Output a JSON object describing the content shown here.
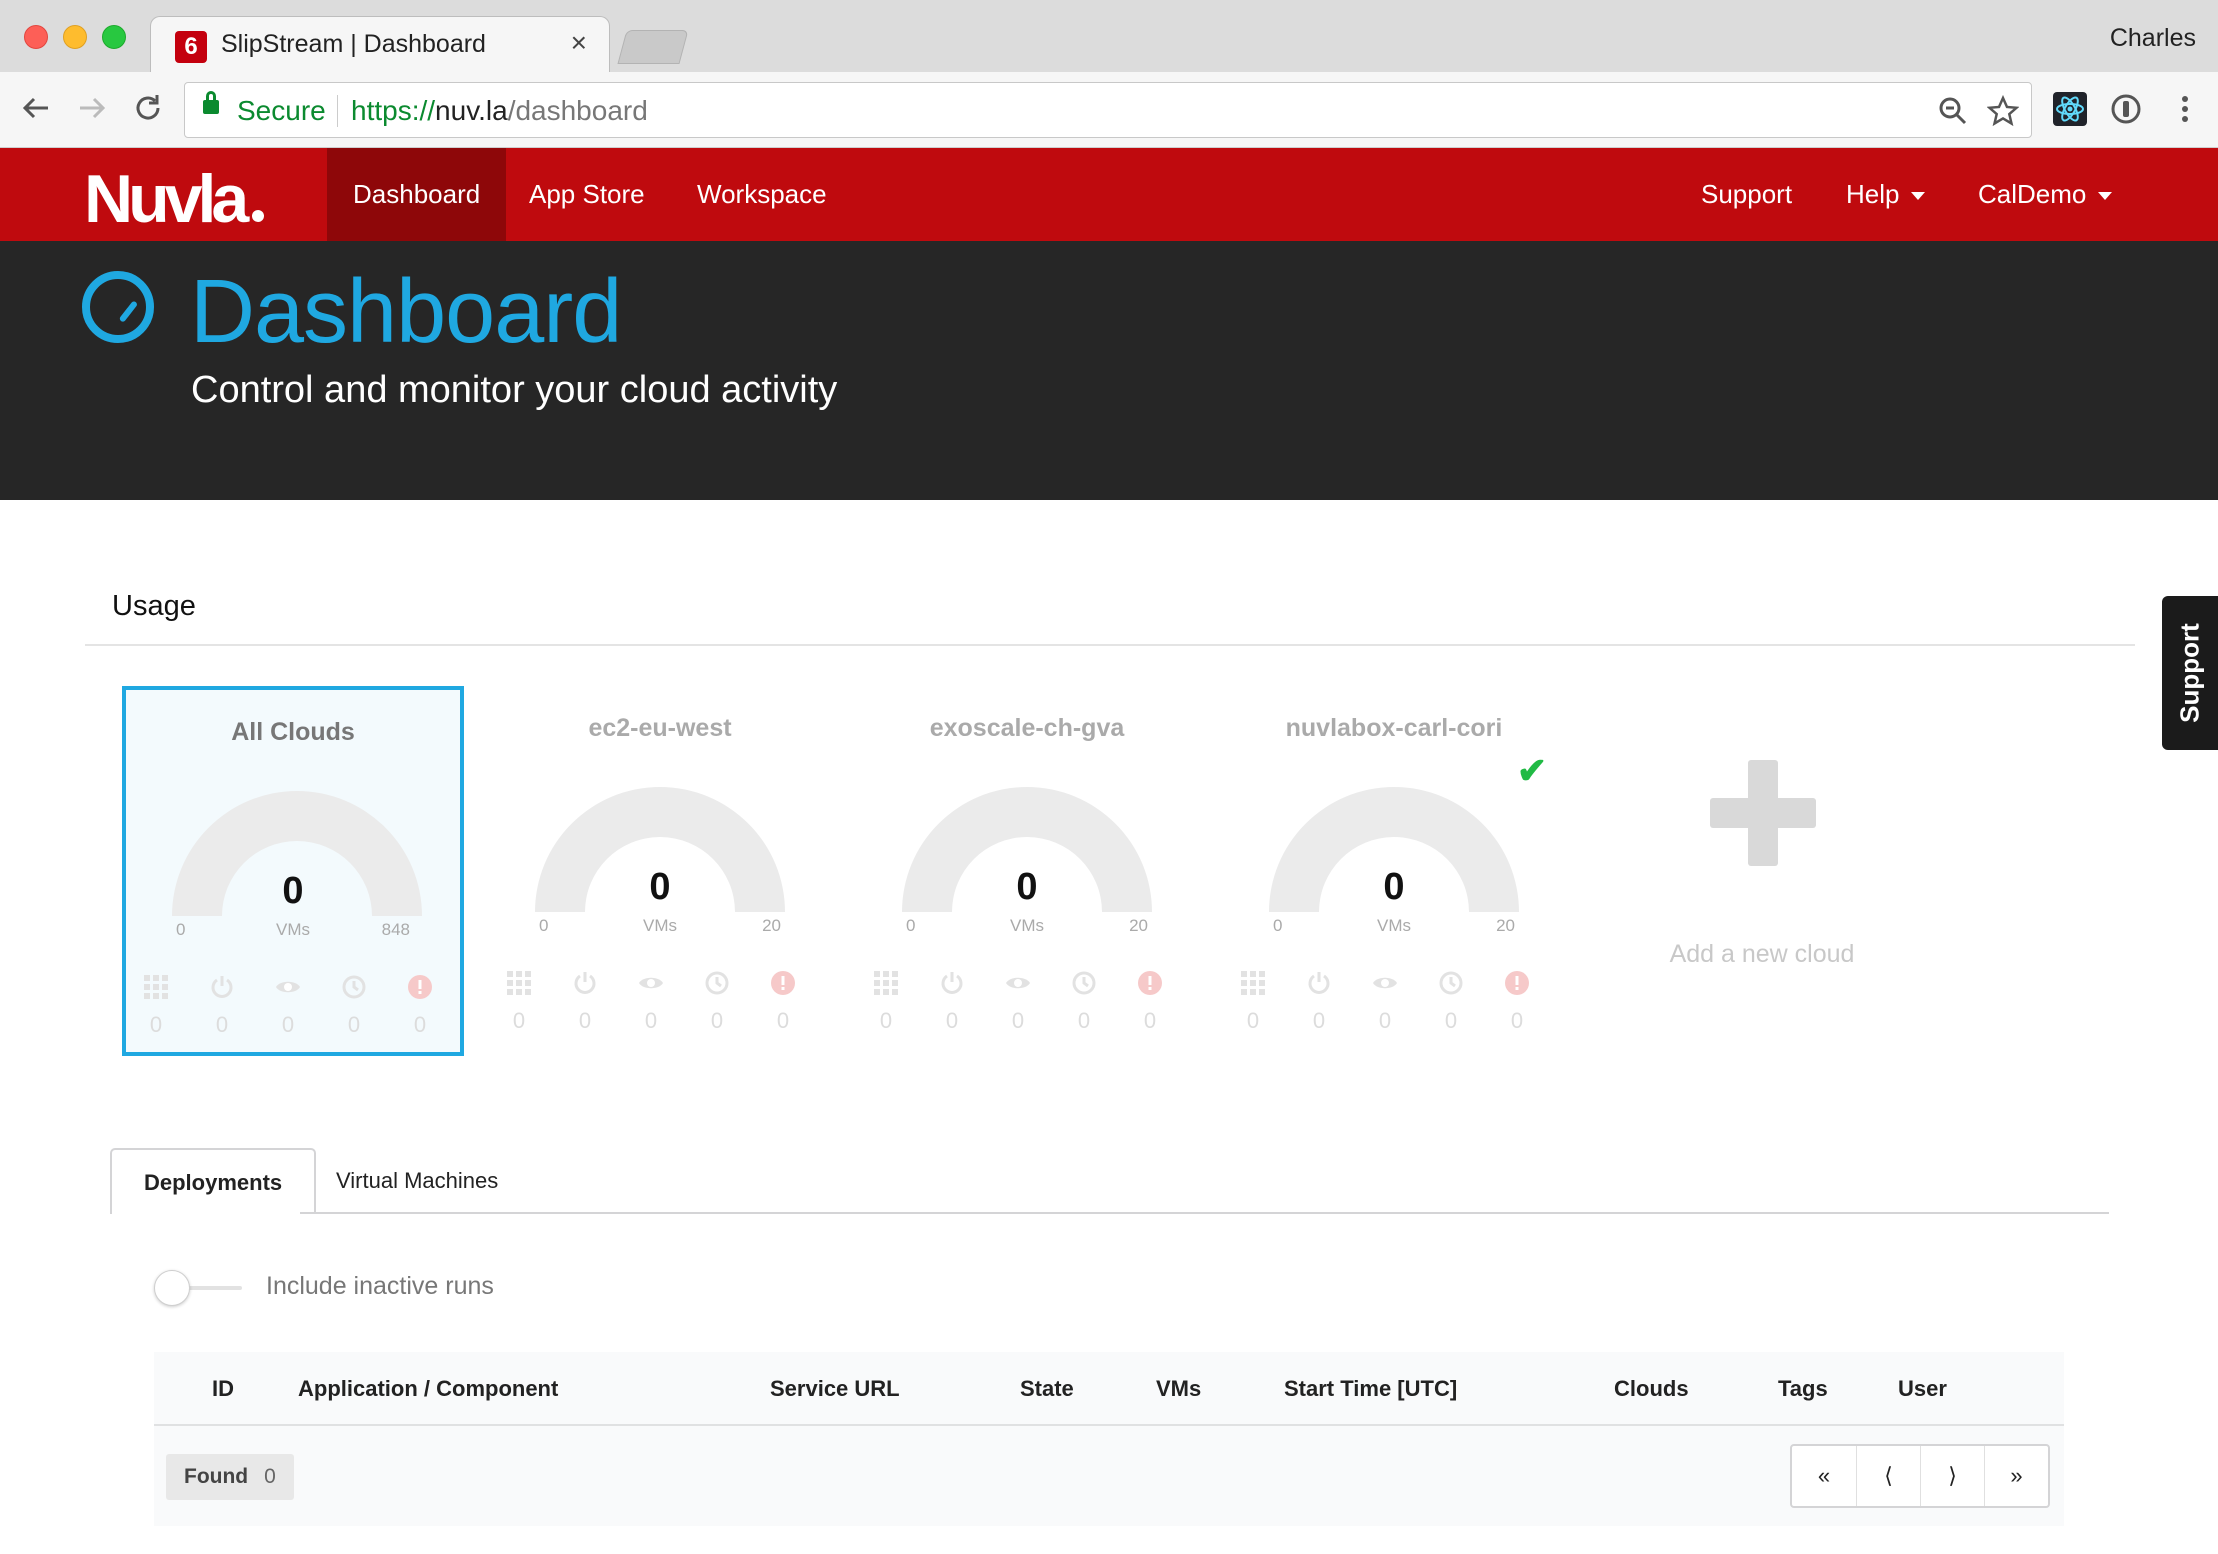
{
  "browser": {
    "tab_title": "SlipStream | Dashboard",
    "tab_close": "×",
    "profile_name": "Charles",
    "secure_label": "Secure",
    "url_protocol": "https://",
    "url_host": "nuv.la",
    "url_path": "/dashboard",
    "favicon_text": "6"
  },
  "nav": {
    "logo_text": "Nuvla",
    "items": [
      {
        "label": "Dashboard",
        "active": true
      },
      {
        "label": "App Store",
        "active": false
      },
      {
        "label": "Workspace",
        "active": false
      }
    ],
    "right": {
      "support": "Support",
      "help": "Help",
      "user": "CalDemo"
    },
    "brand_color": "#bf0a0e"
  },
  "hero": {
    "title": "Dashboard",
    "subtitle": "Control and monitor your cloud activity",
    "accent_color": "#1fa8e1",
    "icon": "dashboard-gauge-icon"
  },
  "side_tab": "Support",
  "usage": {
    "title": "Usage",
    "unit": "VMs",
    "stat_icons": [
      "grid-icon",
      "power-icon",
      "eye-icon",
      "clock-icon",
      "error-icon"
    ],
    "clouds": [
      {
        "name": "All Clouds",
        "value": "0",
        "min": "0",
        "max": "848",
        "selected": true,
        "checked": false,
        "stats": [
          "0",
          "0",
          "0",
          "0",
          "0"
        ]
      },
      {
        "name": "ec2-eu-west",
        "value": "0",
        "min": "0",
        "max": "20",
        "selected": false,
        "checked": false,
        "stats": [
          "0",
          "0",
          "0",
          "0",
          "0"
        ]
      },
      {
        "name": "exoscale-ch-gva",
        "value": "0",
        "min": "0",
        "max": "20",
        "selected": false,
        "checked": false,
        "stats": [
          "0",
          "0",
          "0",
          "0",
          "0"
        ]
      },
      {
        "name": "nuvlabox-carl-cori",
        "value": "0",
        "min": "0",
        "max": "20",
        "selected": false,
        "checked": true,
        "stats": [
          "0",
          "0",
          "0",
          "0",
          "0"
        ]
      }
    ],
    "add_cloud_label": "Add a new cloud"
  },
  "panel": {
    "tabs": [
      {
        "label": "Deployments",
        "active": true
      },
      {
        "label": "Virtual Machines",
        "active": false
      }
    ],
    "toggle_label": "Include inactive runs",
    "toggle_on": false,
    "columns": [
      "ID",
      "Application / Component",
      "Service URL",
      "State",
      "VMs",
      "Start Time [UTC]",
      "Clouds",
      "Tags",
      "User"
    ],
    "found_label": "Found",
    "found_count": "0",
    "pager": [
      "«",
      "⟨",
      "⟩",
      "»"
    ]
  }
}
